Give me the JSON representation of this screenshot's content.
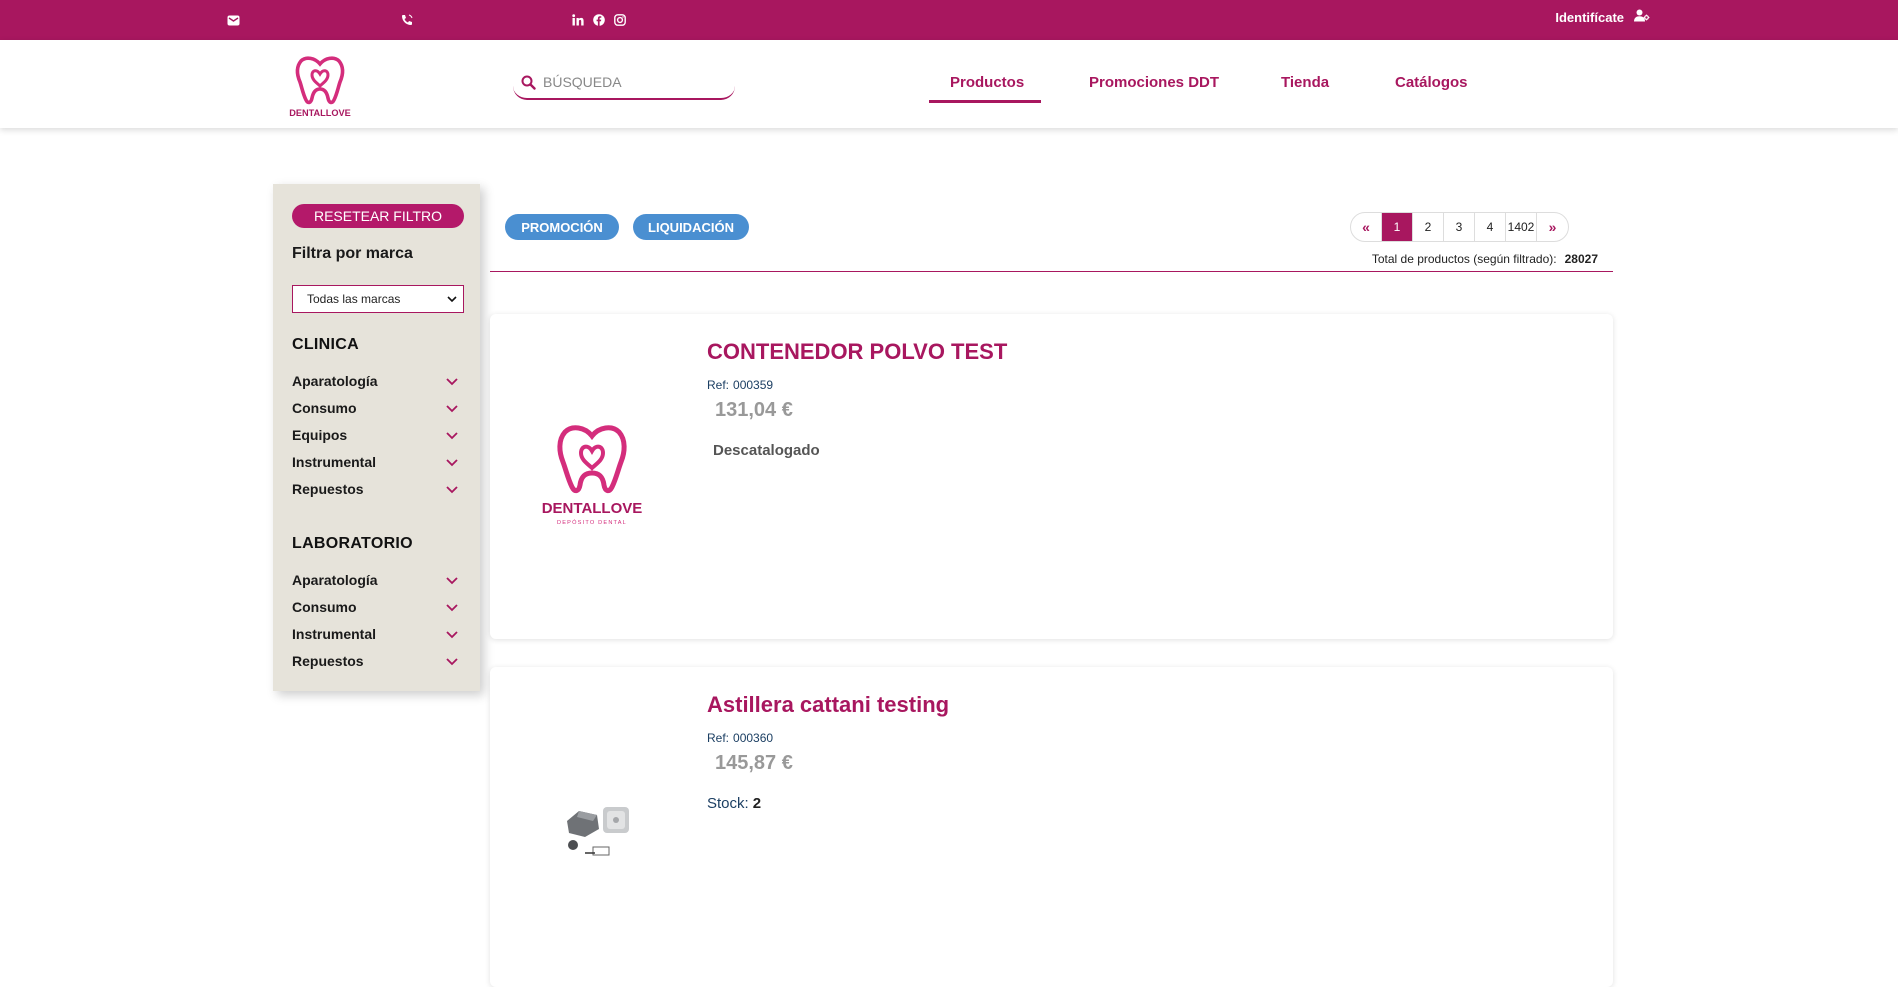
{
  "topbar": {
    "icons": [
      "envelope-icon",
      "phone-icon",
      "linkedin-icon",
      "facebook-icon",
      "instagram-icon",
      "user-icon"
    ],
    "login_label": "Identifícate"
  },
  "brand": {
    "name": "DENTALLOVE",
    "tagline": "DEPÓSITO DENTAL",
    "color": "#a8175f"
  },
  "search": {
    "placeholder": "BÚSQUEDA"
  },
  "nav": {
    "items": [
      {
        "label": "Productos",
        "active": true
      },
      {
        "label": "Promociones DDT"
      },
      {
        "label": "Tienda"
      },
      {
        "label": "Catálogos"
      }
    ]
  },
  "sidebar": {
    "reset_label": "RESETEAR FILTRO",
    "brand_filter_title": "Filtra por marca",
    "brand_select_value": "Todas las marcas",
    "groups": [
      {
        "title": "CLINICA",
        "items": [
          "Aparatología",
          "Consumo",
          "Equipos",
          "Instrumental",
          "Repuestos"
        ]
      },
      {
        "title": "LABORATORIO",
        "items": [
          "Aparatología",
          "Consumo",
          "Instrumental",
          "Repuestos"
        ]
      }
    ]
  },
  "tags": {
    "promo": "PROMOCIÓN",
    "liquid": "LIQUIDACIÓN"
  },
  "pagination": {
    "pages": [
      "1",
      "2",
      "3",
      "4",
      "1402"
    ],
    "current": "1"
  },
  "totals": {
    "label": "Total de productos (según filtrado):",
    "value": "28027"
  },
  "products": [
    {
      "name": "CONTENEDOR POLVO TEST",
      "ref_label": "Ref:",
      "ref": "000359",
      "price": "131,04 €",
      "status": "Descatalogado"
    },
    {
      "name": "Astillera cattani testing",
      "ref_label": "Ref:",
      "ref": "000360",
      "price": "145,87 €",
      "stock_label": "Stock:",
      "stock": "2"
    }
  ]
}
